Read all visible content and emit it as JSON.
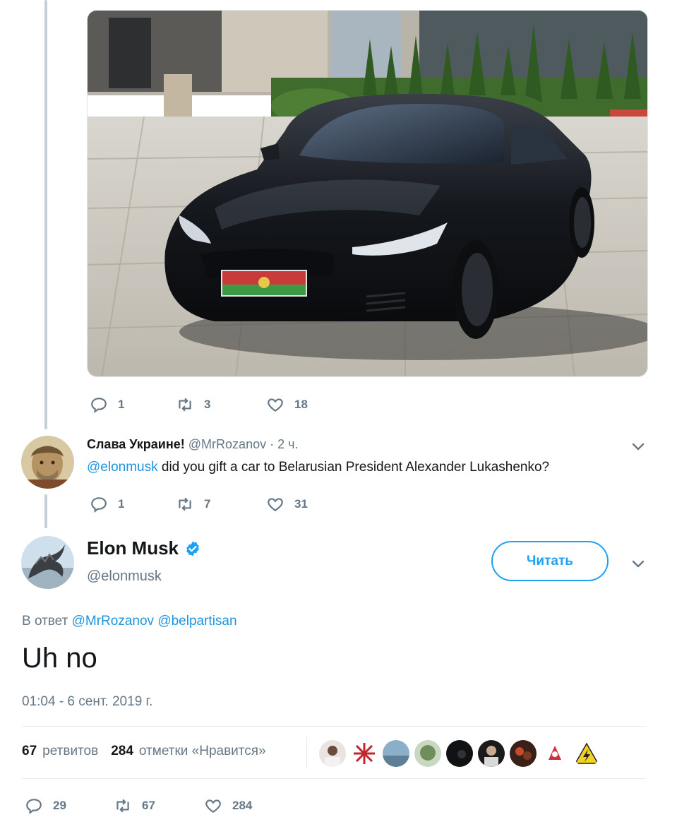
{
  "tweet_above": {
    "actions": {
      "replies": "1",
      "retweets": "3",
      "likes": "18"
    }
  },
  "reply": {
    "display_name": "Слава Украине!",
    "handle": "@MrRozanov",
    "time": "· 2 ч.",
    "mention": "@elonmusk",
    "text": " did you gift a car to Belarusian President Alexander Lukashenko?",
    "actions": {
      "replies": "1",
      "retweets": "7",
      "likes": "31"
    }
  },
  "main_tweet": {
    "display_name": "Elon Musk",
    "handle": "@elonmusk",
    "follow_label": "Читать",
    "reply_to_prefix": "В ответ ",
    "reply_to_1": "@MrRozanov",
    "reply_to_2": "@belpartisan",
    "text": "Uh no",
    "timestamp": "01:04 - 6 сент. 2019 г.",
    "retweets_count": "67",
    "retweets_label": "ретвитов",
    "likes_count": "284",
    "likes_label": "отметки «Нравится»",
    "actions": {
      "replies": "29",
      "retweets": "67",
      "likes": "284"
    }
  },
  "colors": {
    "accent": "#1da1f2",
    "mention": "#1b95e0",
    "muted": "#657786",
    "verified": "#1da1f2"
  },
  "icons": {
    "reply": "reply-icon",
    "retweet": "retweet-icon",
    "like": "heart-icon",
    "more": "chevron-down-icon",
    "verified": "verified-badge-icon"
  }
}
